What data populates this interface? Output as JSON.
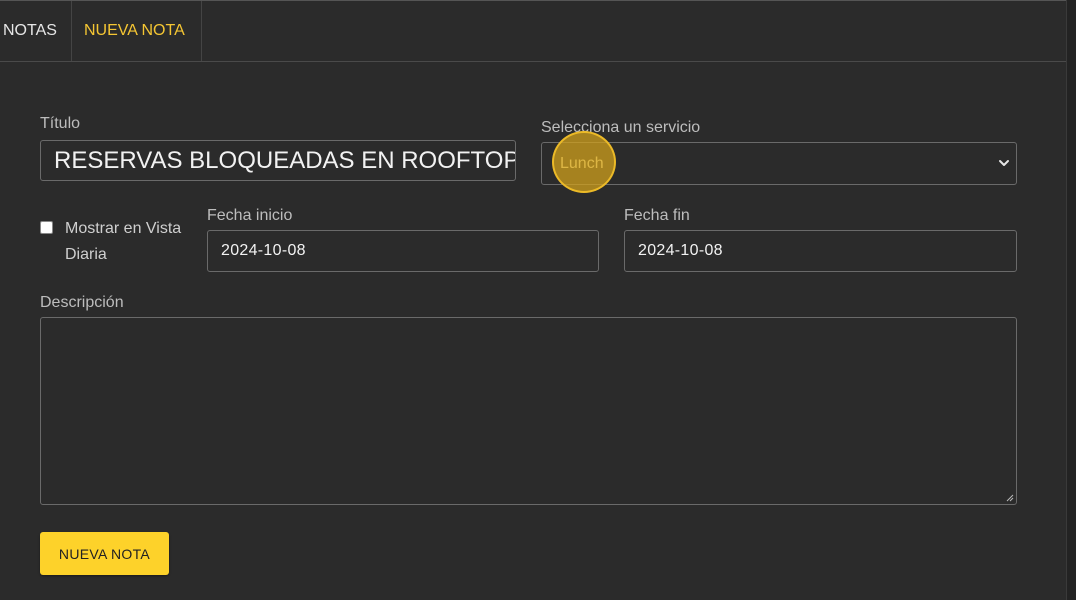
{
  "tabs": [
    {
      "label": "NOTAS",
      "active": false
    },
    {
      "label": "NUEVA NOTA",
      "active": true
    }
  ],
  "form": {
    "title_label": "Título",
    "title_value": "RESERVAS BLOQUEADAS EN ROOFTOP",
    "service_label": "Selecciona un servicio",
    "service_value": "Lunch",
    "show_daily_label": "Mostrar en Vista Diaria",
    "show_daily_checked": false,
    "start_date_label": "Fecha inicio",
    "start_date_value": "2024-10-08",
    "end_date_label": "Fecha fin",
    "end_date_value": "2024-10-08",
    "description_label": "Descripción",
    "description_value": "",
    "submit_label": "NUEVA NOTA"
  },
  "icons": {
    "select_chevron": "chevron-down-icon",
    "textarea_resize": "resize-grip-icon"
  },
  "colors": {
    "background": "#2b2b2b",
    "accent": "#f5c633",
    "button": "#fdd22a",
    "highlight": "#d6a41a"
  }
}
